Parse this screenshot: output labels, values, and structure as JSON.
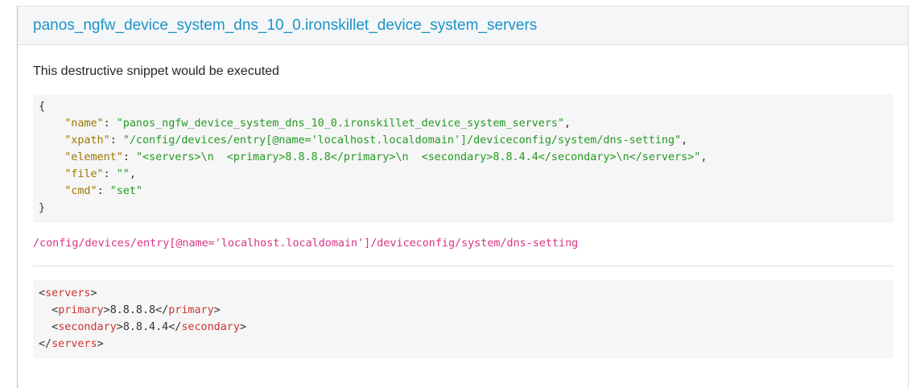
{
  "card": {
    "title": "panos_ngfw_device_system_dns_10_0.ironskillet_device_system_servers",
    "message": "This destructive snippet would be executed"
  },
  "json_snippet": {
    "open_brace": "{",
    "close_brace": "}",
    "fields": [
      {
        "key": "\"name\"",
        "sep": ": ",
        "value": "\"panos_ngfw_device_system_dns_10_0.ironskillet_device_system_servers\"",
        "trail": ","
      },
      {
        "key": "\"xpath\"",
        "sep": ": ",
        "value": "\"/config/devices/entry[@name='localhost.localdomain']/deviceconfig/system/dns-setting\"",
        "trail": ","
      },
      {
        "key": "\"element\"",
        "sep": ": ",
        "value": "\"<servers>\\n  <primary>8.8.8.8</primary>\\n  <secondary>8.8.4.4</secondary>\\n</servers>\"",
        "trail": ","
      },
      {
        "key": "\"file\"",
        "sep": ": ",
        "value": "\"\"",
        "trail": ","
      },
      {
        "key": "\"cmd\"",
        "sep": ": ",
        "value": "\"set\"",
        "trail": ""
      }
    ]
  },
  "xpath_text": "/config/devices/entry[@name='localhost.localdomain']/deviceconfig/system/dns-setting",
  "xml_snippet": {
    "lt": "<",
    "gt": ">",
    "close_lt": "</",
    "root_tag": "servers",
    "children": [
      {
        "tag": "primary",
        "value": "8.8.8.8"
      },
      {
        "tag": "secondary",
        "value": "8.8.4.4"
      }
    ]
  },
  "colors": {
    "title": "#1b93c9",
    "json_key": "#997700",
    "json_string": "#229922",
    "xml_tag": "#cc3333",
    "xpath": "#d63384",
    "code_background": "#f6f6f6"
  }
}
